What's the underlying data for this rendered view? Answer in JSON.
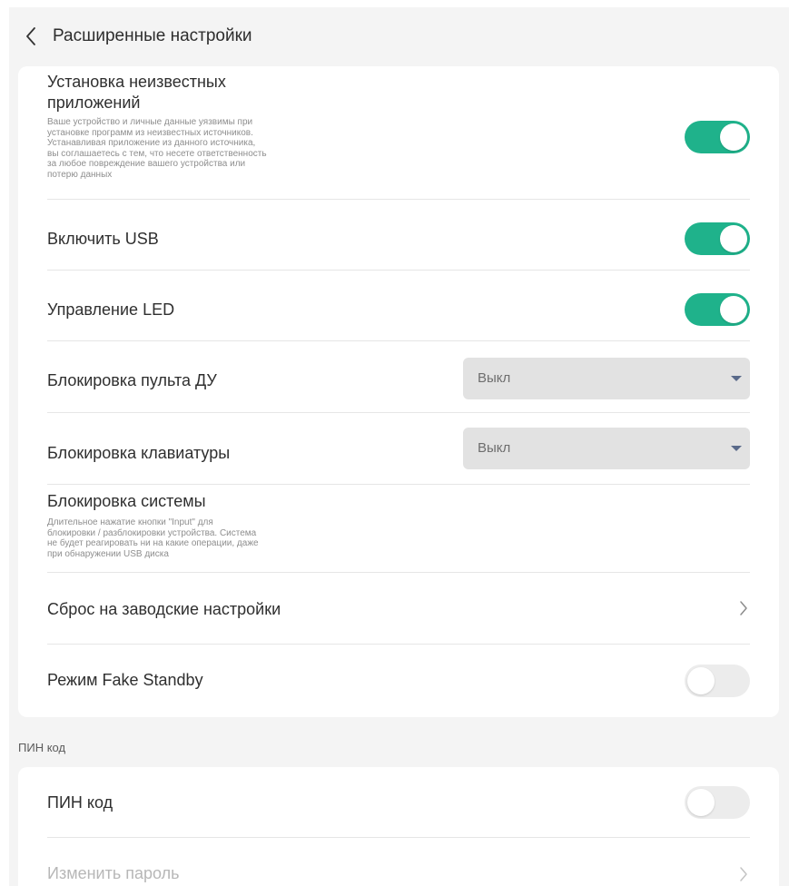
{
  "header": {
    "title": "Расширенные настройки",
    "back_icon": "chevron-left-icon"
  },
  "settings": {
    "unknown_apps": {
      "title_line1": "Установка неизвестных",
      "title_line2": "приложений",
      "desc": [
        "Ваше устройство и личные данные уязвимы при",
        "установке программ из неизвестных источников.",
        "Устанавливая приложение из данного источника,",
        "вы соглашаетесь с тем, что несете ответственность",
        "за любое повреждение вашего устройства или",
        "потерю данных"
      ],
      "enabled": true
    },
    "usb": {
      "title": "Включить USB",
      "enabled": true
    },
    "led": {
      "title": "Управление LED",
      "enabled": true
    },
    "remote_lock": {
      "title": "Блокировка пульта ДУ",
      "value": "Выкл"
    },
    "keyboard_lock": {
      "title": "Блокировка клавиатуры",
      "value": "Выкл"
    },
    "system_lock": {
      "title": "Блокировка системы",
      "desc": [
        "Длительное нажатие кнопки \"Input\" для",
        "блокировки / разблокировки устройства. Система",
        "не будет реагировать ни на какие операции, даже",
        "при обнаружении USB диска"
      ]
    },
    "factory_reset": {
      "title": "Сброс на заводские настройки"
    },
    "fake_standby": {
      "title": "Режим Fake Standby",
      "enabled": false
    }
  },
  "pin_section": {
    "label": "ПИН код",
    "pin": {
      "title": "ПИН код",
      "enabled": false
    },
    "change_password": {
      "title": "Изменить пароль"
    }
  },
  "colors": {
    "accent": "#1fb28b",
    "toggle_off": "#ececec",
    "select_bg": "#e2e2e2",
    "page_bg": "#f4f4f4"
  }
}
